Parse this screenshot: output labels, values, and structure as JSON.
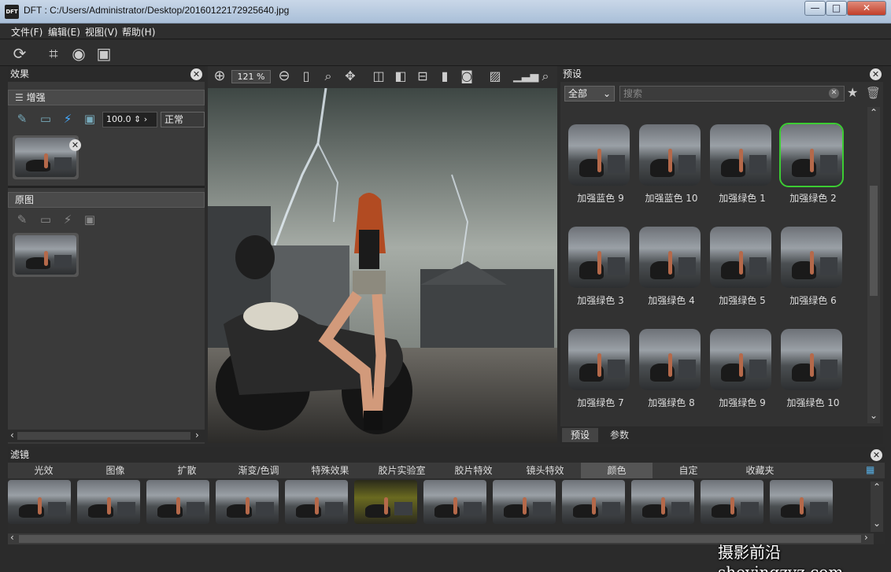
{
  "window": {
    "title": "DFT : C:/Users/Administrator/Desktop/20160122172925640.jpg",
    "logo": "DFT",
    "min": "—",
    "max": "□",
    "close": "✕"
  },
  "menu": [
    "文件(F)",
    "编辑(E)",
    "视图(V)",
    "帮助(H)"
  ],
  "left": {
    "panel_title": "效果",
    "effect_name": "增强",
    "opacity_value": "100.0",
    "blend_mode": "正常",
    "original_label": "原图"
  },
  "canvas": {
    "zoom": "121 %"
  },
  "right": {
    "panel_title": "预设",
    "category": "全部",
    "search_placeholder": "搜索",
    "presets": [
      "加强蓝色 9",
      "加强蓝色 10",
      "加强绿色 1",
      "加强绿色 2",
      "加强绿色 3",
      "加强绿色 4",
      "加强绿色 5",
      "加强绿色 6",
      "加强绿色 7",
      "加强绿色 8",
      "加强绿色 9",
      "加强绿色 10"
    ],
    "selected_preset": 3,
    "tab_presets": "预设",
    "tab_params": "参数"
  },
  "filters": {
    "panel_title": "滤镜",
    "tabs": [
      "光效",
      "图像",
      "扩散",
      "渐变/色调",
      "特殊效果",
      "胶片实验室",
      "胶片特效",
      "镜头特效",
      "颜色",
      "自定",
      "收藏夹"
    ],
    "active_tab": 8
  },
  "watermark": "摄影前沿 sheyingzyz.com",
  "colors": {
    "selected_outline": "#3ccc33",
    "background": "#2b2b2b"
  }
}
